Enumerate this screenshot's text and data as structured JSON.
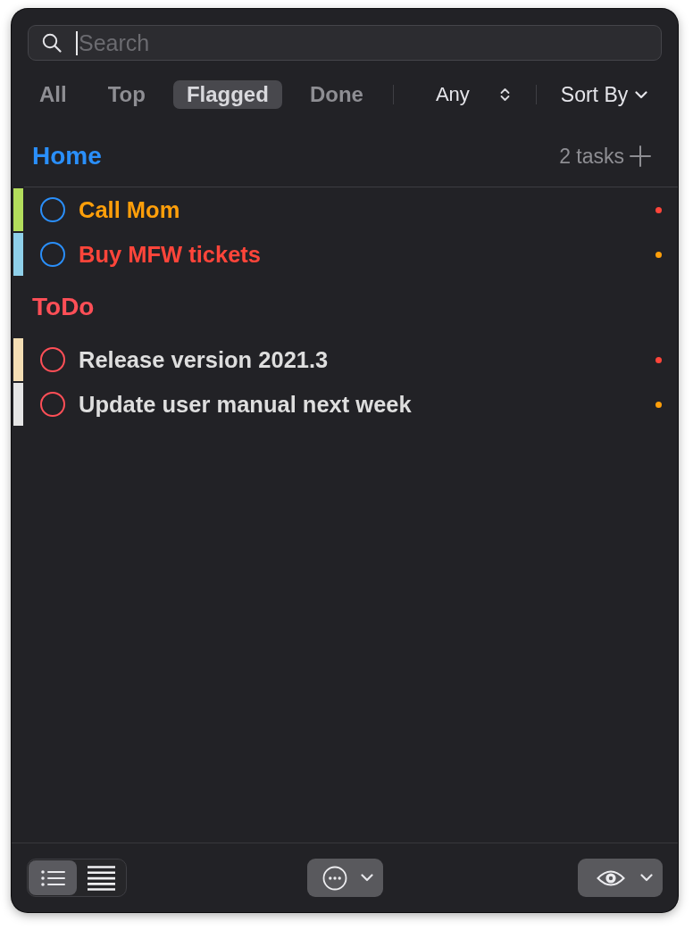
{
  "search": {
    "placeholder": "Search",
    "focused": true
  },
  "filters": [
    {
      "label": "All",
      "selected": false
    },
    {
      "label": "Top",
      "selected": false
    },
    {
      "label": "Flagged",
      "selected": true
    },
    {
      "label": "Done",
      "selected": false
    }
  ],
  "priority_picker": {
    "value": "Any"
  },
  "sort_menu": {
    "label": "Sort By"
  },
  "sections": [
    {
      "title": "Home",
      "color": "#2a8ffa",
      "task_count": "2 tasks",
      "tasks": [
        {
          "tag": {
            "color": "#b3dd5c"
          },
          "checked": false,
          "title": {
            "text": "Call Mom",
            "color": "#ff9f0a"
          },
          "dot": {
            "color": "#ff453a"
          }
        },
        {
          "tag": {
            "color": "#8fd0ea"
          },
          "checked": false,
          "title": {
            "text": "Buy MFW tickets",
            "color": "#ff453a"
          },
          "dot": {
            "color": "#ff9f0a"
          }
        }
      ]
    },
    {
      "title": "ToDo",
      "color": "#ff4f57",
      "tasks": [
        {
          "tag": {
            "color": "#f4deb4"
          },
          "checked": false,
          "title": {
            "text": "Release version 2021.3",
            "color": "#dedede"
          },
          "dot": {
            "color": "#ff453a"
          }
        },
        {
          "tag": {
            "color": "#e6e6e6"
          },
          "checked": false,
          "title": {
            "text": "Update user manual next week",
            "color": "#dedede"
          },
          "dot": {
            "color": "#ff9f0a"
          }
        }
      ]
    }
  ],
  "view_modes": [
    {
      "kind": "list",
      "selected": true
    },
    {
      "kind": "compact",
      "selected": false
    }
  ]
}
